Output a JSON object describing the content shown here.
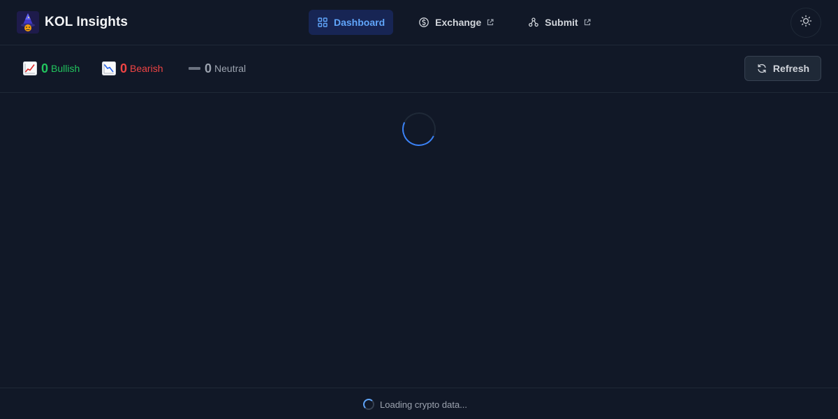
{
  "header": {
    "brand_name": "KOL Insights",
    "logo_icon": "wizard-logo-icon",
    "nav": [
      {
        "label": "Dashboard",
        "icon": "grid-icon",
        "active": true,
        "external": false
      },
      {
        "label": "Exchange",
        "icon": "dollar-circle-icon",
        "active": false,
        "external": true
      },
      {
        "label": "Submit",
        "icon": "share-nodes-icon",
        "active": false,
        "external": true
      }
    ],
    "theme_toggle_icon": "sun-icon"
  },
  "stats": {
    "bullish": {
      "count": "0",
      "label": "Bullish",
      "icon": "chart-up-icon",
      "color": "#22c55e"
    },
    "bearish": {
      "count": "0",
      "label": "Bearish",
      "icon": "chart-down-icon",
      "color": "#ef4444"
    },
    "neutral": {
      "count": "0",
      "label": "Neutral",
      "icon": "dash-icon",
      "color": "#9ca3af"
    },
    "refresh_label": "Refresh",
    "refresh_icon": "refresh-icon"
  },
  "footer": {
    "loading_text": "Loading crypto data..."
  },
  "colors": {
    "background": "#111827",
    "accent": "#3b82f6",
    "active_nav_bg": "#172554"
  }
}
